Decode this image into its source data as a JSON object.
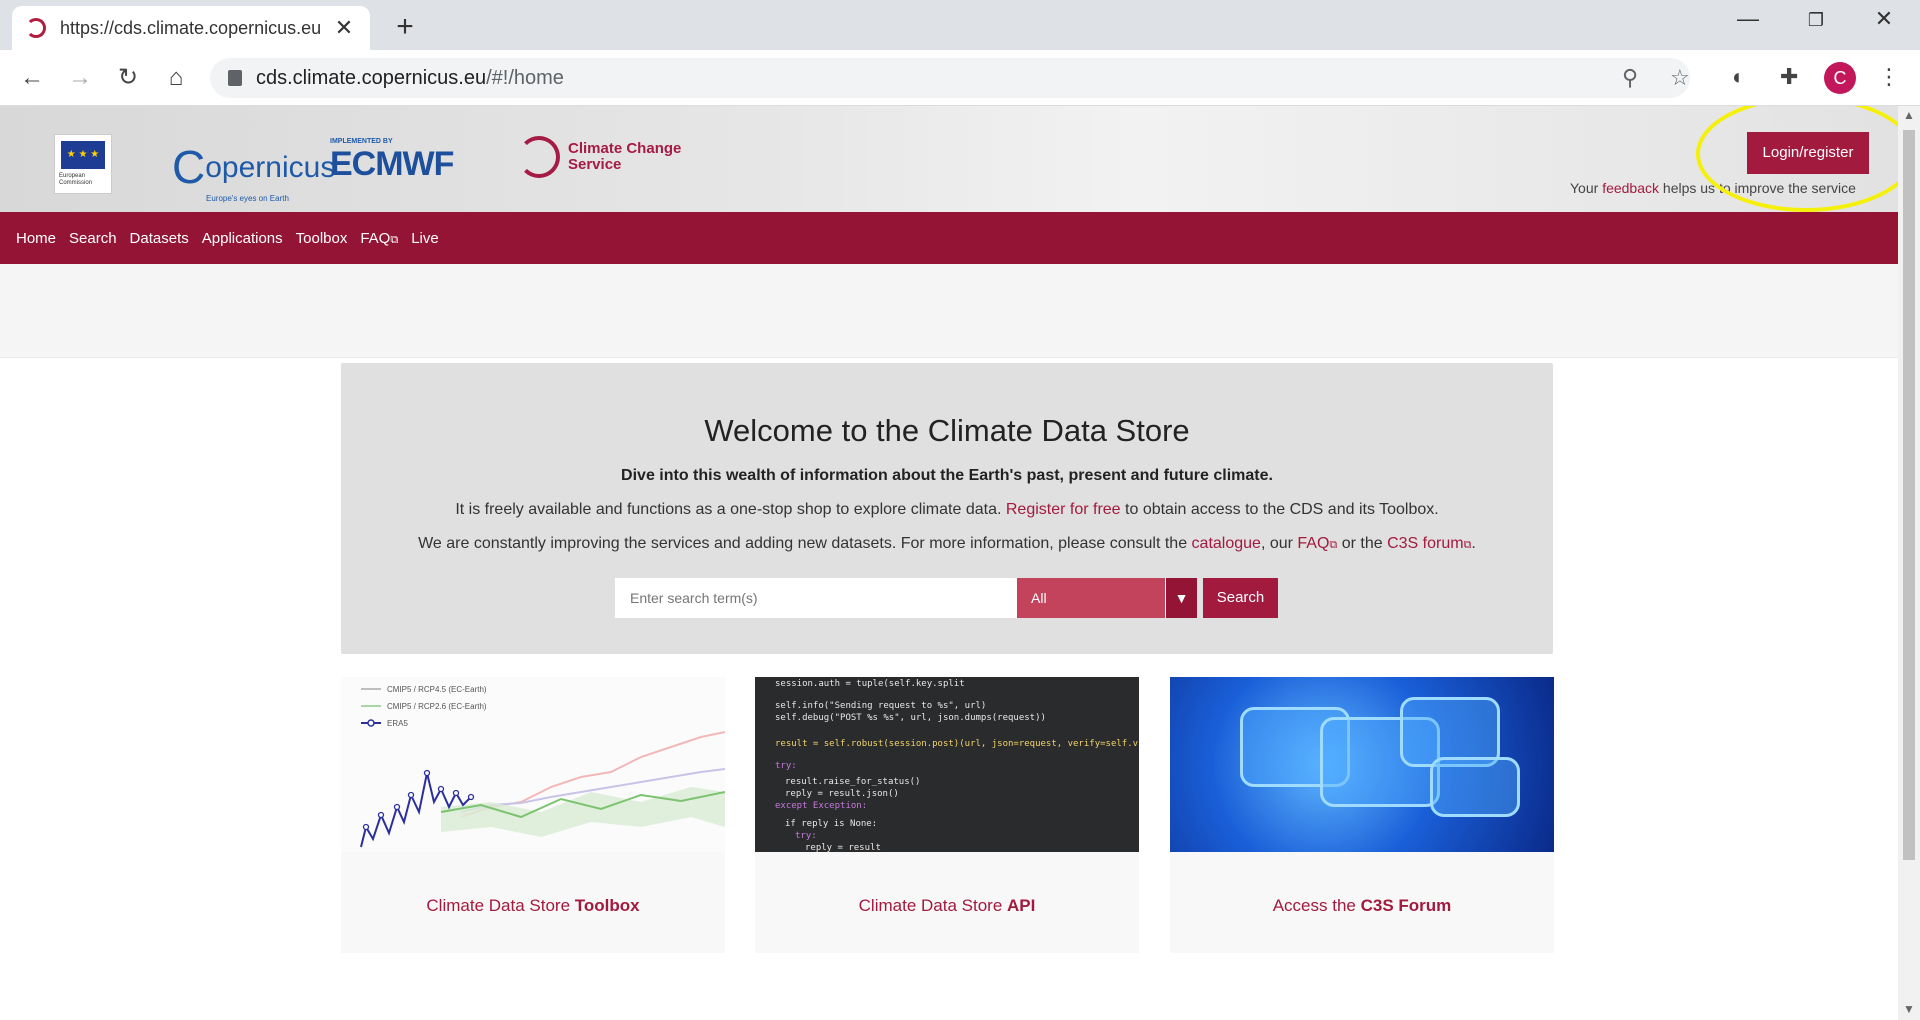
{
  "browser": {
    "tab_title": "https://cds.climate.copernicus.eu",
    "url_host": "cds.climate.copernicus.eu",
    "url_path": "/#!/home",
    "profile_initial": "C"
  },
  "header": {
    "eu_label": "European Commission",
    "copernicus_name": "opernicus",
    "copernicus_c": "C",
    "copernicus_tagline": "Europe's eyes on Earth",
    "ecmwf_implemented": "IMPLEMENTED BY",
    "ecmwf_name": "ECMWF",
    "c3s_line1": "Climate Change",
    "c3s_line2": "Service",
    "login_label": "Login/register",
    "feedback_prefix": "Your ",
    "feedback_link": "feedback",
    "feedback_suffix": " helps us to improve the service"
  },
  "nav": {
    "items": [
      "Home",
      "Search",
      "Datasets",
      "Applications",
      "Toolbox",
      "FAQ",
      "Live"
    ]
  },
  "hero": {
    "title": "Welcome to the Climate Data Store",
    "subtitle": "Dive into this wealth of information about the Earth's past, present and future climate.",
    "p1_pre": "It is freely available and functions as a one-stop shop to explore climate data. ",
    "p1_link": "Register for free",
    "p1_post": " to obtain access to the CDS and its Toolbox.",
    "p2_pre": "We are constantly improving the services and adding new datasets. For more information, please consult the ",
    "p2_link1": "catalogue",
    "p2_mid1": ", our ",
    "p2_link2": "FAQ",
    "p2_mid2": " or the ",
    "p2_link3": "C3S forum",
    "p2_end": ".",
    "search_placeholder": "Enter search term(s)",
    "search_scope": "All",
    "search_button": "Search"
  },
  "cards": [
    {
      "prefix": "Climate Data Store ",
      "bold": "Toolbox"
    },
    {
      "prefix": "Climate Data Store ",
      "bold": "API"
    },
    {
      "prefix": "Access the ",
      "bold": "C3S Forum"
    }
  ],
  "chart_legend": [
    "CMIP5 / RCP4.5 (EC-Earth)",
    "CMIP5 / RCP2.6 (EC-Earth)",
    "ERA5"
  ],
  "code_lines": [
    "session.auth = tuple(self.key.split",
    "self.info(\"Sending request to %s\", url)",
    "self.debug(\"POST %s %s\", url, json.dumps(request))",
    "result = self.robust(session.post)(url, json=request, verify=self.v",
    "try:",
    "  result.raise_for_status()",
    "  reply = result.json()",
    "except Exception:",
    "  if reply is None:",
    "    try:",
    "      reply = result"
  ],
  "colors": {
    "brand": "#931434",
    "accent": "#a31a3f",
    "highlight": "#f5f00a"
  }
}
